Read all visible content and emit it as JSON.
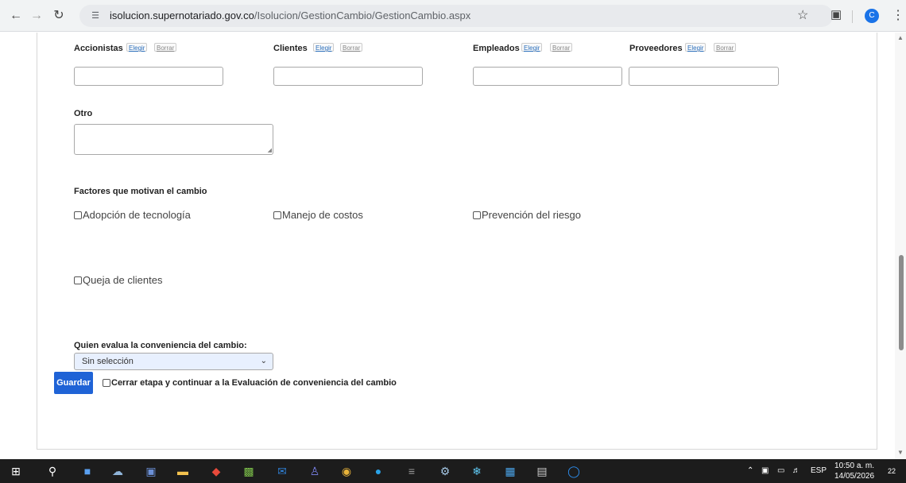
{
  "browser": {
    "url_host": "isolucion.supernotariado.gov.co",
    "url_path": "/Isolucion/GestionCambio/GestionCambio.aspx",
    "profile_initial": "C"
  },
  "form": {
    "stakeholders": [
      {
        "label": "Accionistas",
        "elegir": "Elegir",
        "borrar": "Borrar"
      },
      {
        "label": "Clientes",
        "elegir": "Elegir",
        "borrar": "Borrar"
      },
      {
        "label": "Empleados",
        "elegir": "Elegir",
        "borrar": "Borrar"
      },
      {
        "label": "Proveedores",
        "elegir": "Elegir",
        "borrar": "Borrar"
      }
    ],
    "otro_label": "Otro",
    "factores_label": "Factores que motivan el cambio",
    "factores": [
      {
        "label": "Adopción de tecnología",
        "checked": false
      },
      {
        "label": "Manejo de costos",
        "checked": false
      },
      {
        "label": "Prevención del riesgo",
        "checked": false
      },
      {
        "label": "Queja de clientes",
        "checked": false
      }
    ],
    "evaluador_label": "Quien evalua la conveniencia del cambio:",
    "evaluador_value": "Sin selección",
    "guardar_label": "Guardar",
    "cerrar_label": "Cerrar etapa y continuar a la Evaluación de conveniencia del cambio"
  },
  "taskbar": {
    "tray_lang": "ESP",
    "time": "10:50 a. m.",
    "date": "14/05/2026",
    "notifications": "22"
  },
  "colors": {
    "primary_button": "#1f63d6",
    "select_bg": "#e8f0fe"
  }
}
